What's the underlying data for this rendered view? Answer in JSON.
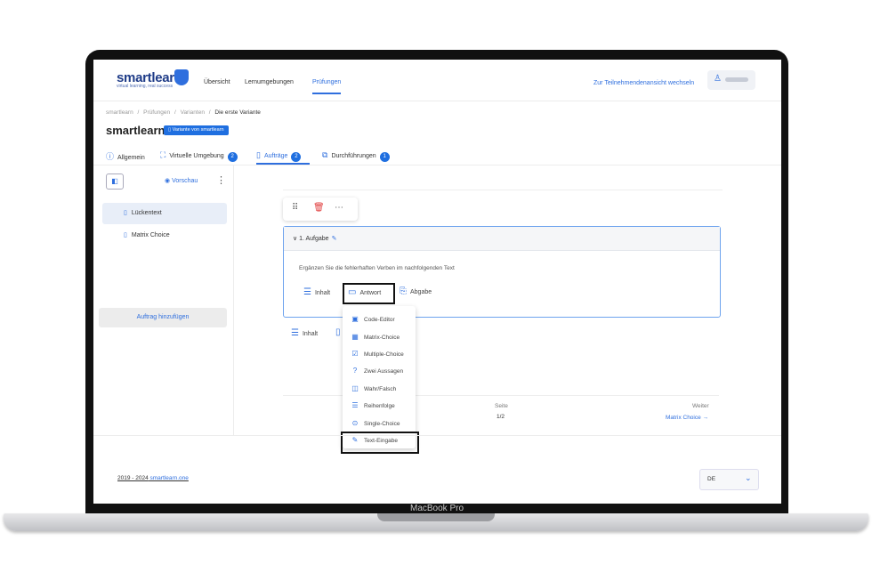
{
  "device": {
    "label": "MacBook Pro"
  },
  "nav": {
    "logo": "smartlearn",
    "logo_sub": "virtual learning, real success",
    "links": [
      "Übersicht",
      "Lernumgebungen",
      "Prüfungen"
    ],
    "switch_view": "Zur Teilnehmendenansicht wechseln"
  },
  "breadcrumb": {
    "items": [
      "smartlearn",
      "Prüfungen",
      "Varianten"
    ],
    "sep": "/",
    "current": "Die erste Variante"
  },
  "title": "smartlearn",
  "variant_badge": "Variante von smartlearn",
  "tabs": [
    {
      "label": "Allgemein",
      "count": ""
    },
    {
      "label": "Virtuelle Umgebung",
      "count": "2"
    },
    {
      "label": "Aufträge",
      "count": "2"
    },
    {
      "label": "Durchführungen",
      "count": "1"
    }
  ],
  "sidebar": {
    "preview": "Vorschau",
    "items": [
      "Lückentext",
      "Matrix Choice"
    ],
    "add_button": "Auftrag hinzufügen"
  },
  "task": {
    "title": "1. Aufgabe",
    "text": "Ergänzen Sie die fehlerhaften Verben im nachfolgenden Text",
    "actions": [
      "Inhalt",
      "Antwort",
      "Abgabe"
    ],
    "bottom_actions": [
      "Inhalt"
    ]
  },
  "dropdown": {
    "items": [
      "Code-Editor",
      "Matrix-Choice",
      "Multiple-Choice",
      "Zwei Aussagen",
      "Wahr/Falsch",
      "Reihenfolge",
      "Single-Choice",
      "Text-Eingabe"
    ]
  },
  "pagination": {
    "page_label": "Seite",
    "page_value": "1/2",
    "next_label": "Weiter",
    "next_value": "Matrix Choice"
  },
  "footer": {
    "year": "2019 - 2024",
    "brand": "smartlearn.one"
  },
  "language": {
    "selected": "DE"
  },
  "colors": {
    "accent": "#2f6fde",
    "badge": "#1f6fe0",
    "delete": "#e03b3b"
  }
}
